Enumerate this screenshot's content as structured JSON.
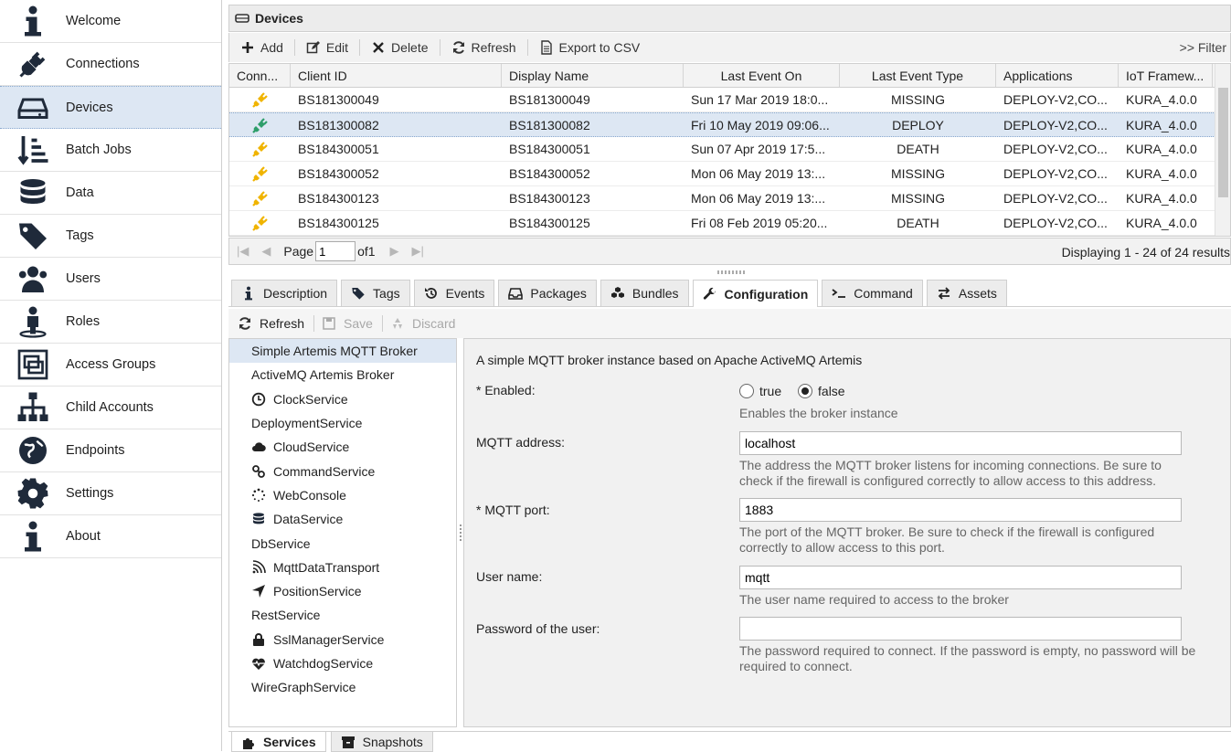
{
  "sidebar": {
    "items": [
      {
        "label": "Welcome",
        "icon": "info-icon"
      },
      {
        "label": "Connections",
        "icon": "plug-icon"
      },
      {
        "label": "Devices",
        "icon": "hdd-icon",
        "active": true
      },
      {
        "label": "Batch Jobs",
        "icon": "sort-icon"
      },
      {
        "label": "Data",
        "icon": "database-icon"
      },
      {
        "label": "Tags",
        "icon": "tags-icon"
      },
      {
        "label": "Users",
        "icon": "users-icon"
      },
      {
        "label": "Roles",
        "icon": "role-icon"
      },
      {
        "label": "Access Groups",
        "icon": "group-icon"
      },
      {
        "label": "Child Accounts",
        "icon": "sitemap-icon"
      },
      {
        "label": "Endpoints",
        "icon": "globe-icon"
      },
      {
        "label": "Settings",
        "icon": "gear-icon"
      },
      {
        "label": "About",
        "icon": "info-icon"
      }
    ]
  },
  "devices": {
    "title": "Devices",
    "toolbar": {
      "add": "Add",
      "edit": "Edit",
      "delete": "Delete",
      "refresh": "Refresh",
      "export": "Export to CSV",
      "filter": ">> Filter"
    },
    "columns": [
      "Conn...",
      "Client ID",
      "Display Name",
      "Last Event On",
      "Last Event Type",
      "Applications",
      "IoT Framew..."
    ],
    "rows": [
      {
        "status": "yellow",
        "client_id": "BS181300049",
        "display_name": "BS181300049",
        "last_event_on": "Sun 17 Mar 2019 18:0...",
        "last_event_type": "MISSING",
        "applications": "DEPLOY-V2,CO...",
        "framework": "KURA_4.0.0"
      },
      {
        "status": "green",
        "client_id": "BS181300082",
        "display_name": "BS181300082",
        "last_event_on": "Fri 10 May 2019 09:06...",
        "last_event_type": "DEPLOY",
        "applications": "DEPLOY-V2,CO...",
        "framework": "KURA_4.0.0",
        "selected": true
      },
      {
        "status": "yellow",
        "client_id": "BS184300051",
        "display_name": "BS184300051",
        "last_event_on": "Sun 07 Apr 2019 17:5...",
        "last_event_type": "DEATH",
        "applications": "DEPLOY-V2,CO...",
        "framework": "KURA_4.0.0"
      },
      {
        "status": "yellow",
        "client_id": "BS184300052",
        "display_name": "BS184300052",
        "last_event_on": "Mon 06 May 2019 13:...",
        "last_event_type": "MISSING",
        "applications": "DEPLOY-V2,CO...",
        "framework": "KURA_4.0.0"
      },
      {
        "status": "yellow",
        "client_id": "BS184300123",
        "display_name": "BS184300123",
        "last_event_on": "Mon 06 May 2019 13:...",
        "last_event_type": "MISSING",
        "applications": "DEPLOY-V2,CO...",
        "framework": "KURA_4.0.0"
      },
      {
        "status": "yellow",
        "client_id": "BS184300125",
        "display_name": "BS184300125",
        "last_event_on": "Fri 08 Feb 2019 05:20...",
        "last_event_type": "DEATH",
        "applications": "DEPLOY-V2,CO...",
        "framework": "KURA_4.0.0"
      }
    ],
    "pager": {
      "page_label": "Page",
      "page_value": "1",
      "of_label": "of1",
      "info": "Displaying 1 - 24 of 24 results"
    }
  },
  "tabs": [
    {
      "label": "Description",
      "icon": "info-icon"
    },
    {
      "label": "Tags",
      "icon": "tags-icon"
    },
    {
      "label": "Events",
      "icon": "history-icon"
    },
    {
      "label": "Packages",
      "icon": "inbox-icon"
    },
    {
      "label": "Bundles",
      "icon": "cubes-icon"
    },
    {
      "label": "Configuration",
      "icon": "wrench-icon",
      "active": true
    },
    {
      "label": "Command",
      "icon": "terminal-icon"
    },
    {
      "label": "Assets",
      "icon": "exchange-icon"
    }
  ],
  "config_toolbar": {
    "refresh": "Refresh",
    "save": "Save",
    "discard": "Discard"
  },
  "services": [
    {
      "label": "Simple Artemis MQTT Broker",
      "icon": "",
      "selected": true
    },
    {
      "label": "ActiveMQ Artemis Broker",
      "icon": ""
    },
    {
      "label": "ClockService",
      "icon": "clock-icon"
    },
    {
      "label": "DeploymentService",
      "icon": ""
    },
    {
      "label": "CloudService",
      "icon": "cloud-icon"
    },
    {
      "label": "CommandService",
      "icon": "link-icon"
    },
    {
      "label": "WebConsole",
      "icon": "spinner-icon"
    },
    {
      "label": "DataService",
      "icon": "database-icon"
    },
    {
      "label": "DbService",
      "icon": ""
    },
    {
      "label": "MqttDataTransport",
      "icon": "rss-icon"
    },
    {
      "label": "PositionService",
      "icon": "location-arrow-icon"
    },
    {
      "label": "RestService",
      "icon": ""
    },
    {
      "label": "SslManagerService",
      "icon": "lock-icon"
    },
    {
      "label": "WatchdogService",
      "icon": "heartbeat-icon"
    },
    {
      "label": "WireGraphService",
      "icon": ""
    }
  ],
  "config": {
    "description": "A simple MQTT broker instance based on Apache ActiveMQ Artemis",
    "enabled_label": "* Enabled:",
    "enabled_true": "true",
    "enabled_false": "false",
    "enabled_help": "Enables the broker instance",
    "address_label": "MQTT address:",
    "address_value": "localhost",
    "address_help": "The address the MQTT broker listens for incoming connections. Be sure to check if the firewall is configured correctly to allow access to this address.",
    "port_label": "* MQTT port:",
    "port_value": "1883",
    "port_help": "The port of the MQTT broker. Be sure to check if the firewall is configured correctly to allow access to this port.",
    "user_label": "User name:",
    "user_value": "mqtt",
    "user_help": "The user name required to access to the broker",
    "password_label": "Password of the user:",
    "password_value": "",
    "password_help": "The password required to connect. If the password is empty, no password will be required to connect."
  },
  "bottom_tabs": [
    {
      "label": "Services",
      "icon": "puzzle-icon",
      "active": true
    },
    {
      "label": "Snapshots",
      "icon": "archive-icon"
    }
  ],
  "colors": {
    "selection": "#dde7f3",
    "plug_yellow": "#f0b400",
    "plug_green": "#2e9e6a",
    "icon_dark": "#1f2a3a"
  }
}
